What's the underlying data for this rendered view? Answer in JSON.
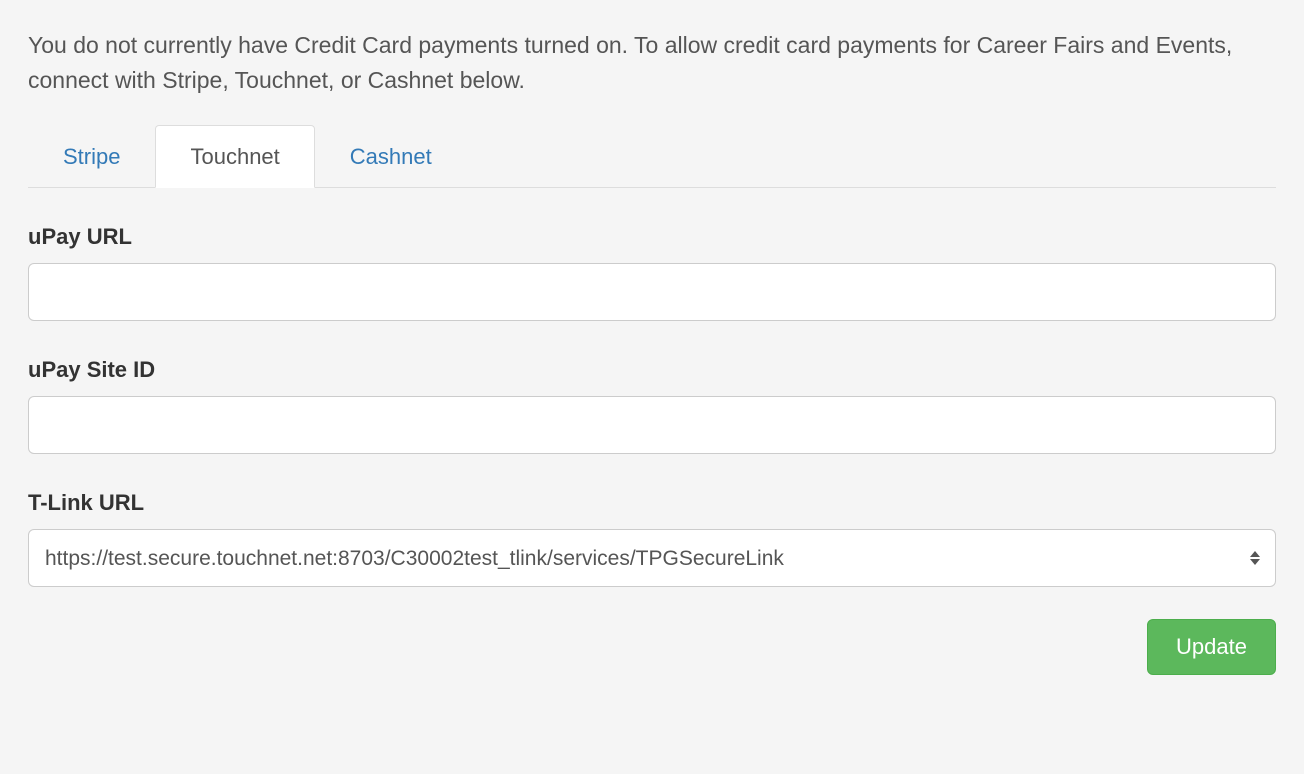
{
  "intro": "You do not currently have Credit Card payments turned on. To allow credit card payments for Career Fairs and Events, connect with Stripe, Touchnet, or Cashnet below.",
  "tabs": {
    "stripe": "Stripe",
    "touchnet": "Touchnet",
    "cashnet": "Cashnet"
  },
  "form": {
    "upay_url_label": "uPay URL",
    "upay_url_value": "",
    "upay_site_id_label": "uPay Site ID",
    "upay_site_id_value": "",
    "tlink_url_label": "T-Link URL",
    "tlink_url_selected": "https://test.secure.touchnet.net:8703/C30002test_tlink/services/TPGSecureLink"
  },
  "actions": {
    "update_label": "Update"
  }
}
